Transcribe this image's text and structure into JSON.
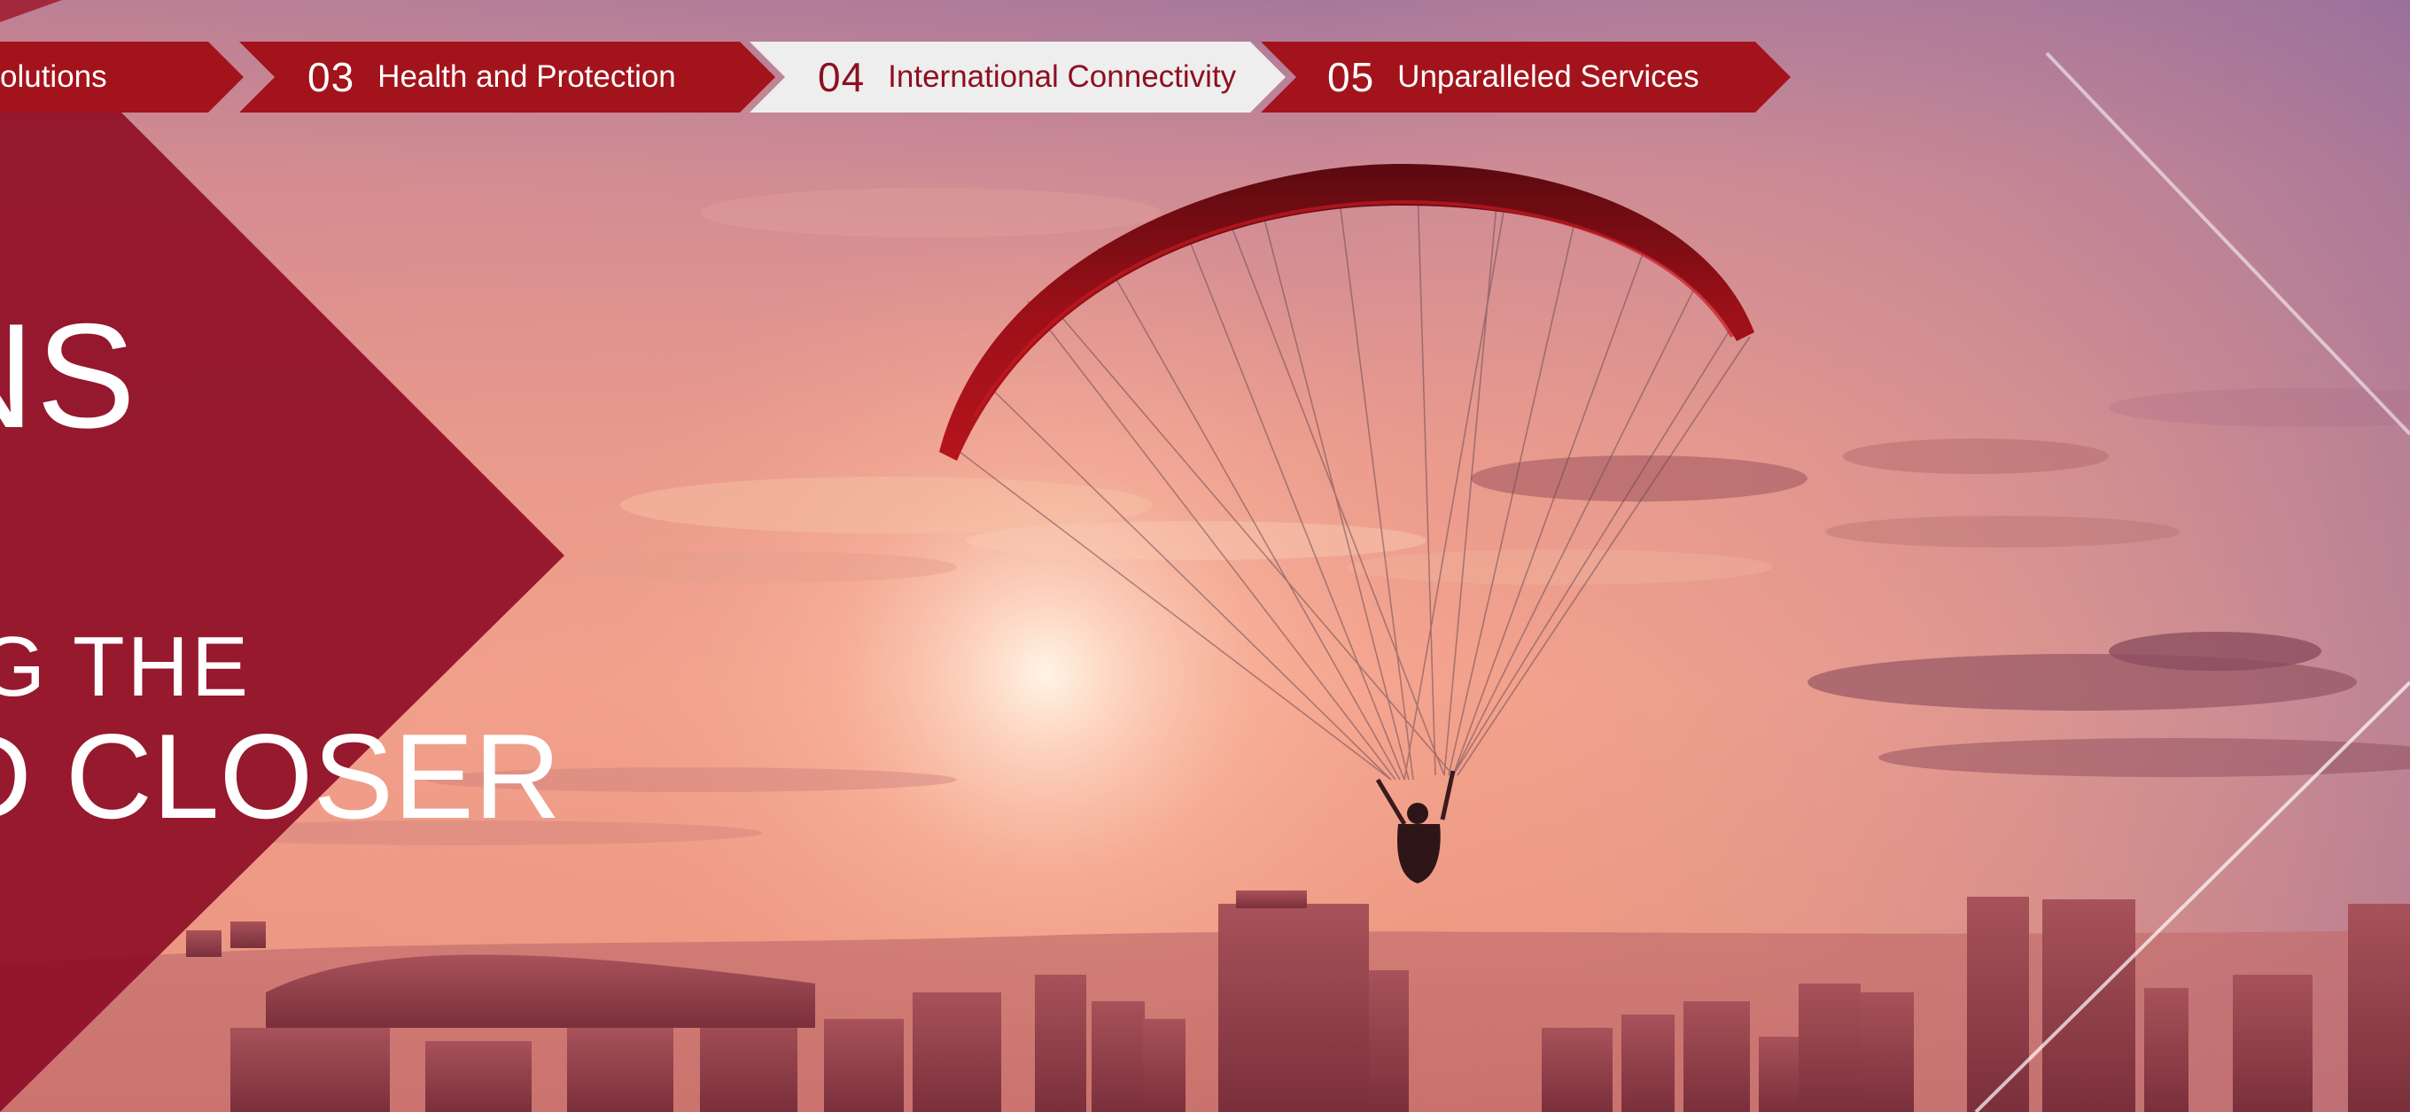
{
  "tabs": [
    {
      "num": "",
      "label": "olutions",
      "state": "inactive"
    },
    {
      "num": "03",
      "label": "Health and Protection",
      "state": "inactive"
    },
    {
      "num": "04",
      "label": "International Connectivity",
      "state": "active"
    },
    {
      "num": "05",
      "label": "Unparalleled Services",
      "state": "inactive"
    }
  ],
  "headline": {
    "line1": "NS",
    "line2": "G THE",
    "line3": "D CLOSER"
  },
  "hero_image": {
    "subject": "paraglider silhouette over city skyline at sunset",
    "icon": "paraglider-icon"
  },
  "colors": {
    "brand_red": "#a3131b",
    "brand_dark": "#8d1020",
    "tab_active_bg": "#eeeeee",
    "text_light": "#ffffff"
  }
}
